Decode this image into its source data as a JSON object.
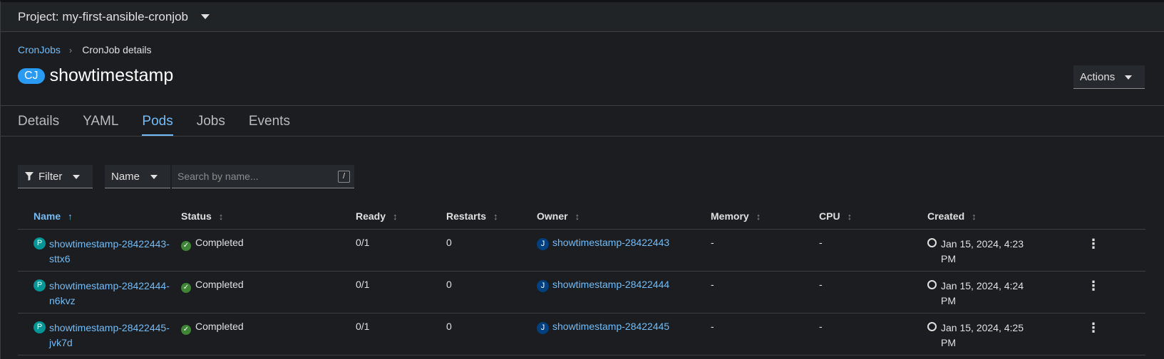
{
  "project_bar": {
    "label": "Project: my-first-ansible-cronjob"
  },
  "breadcrumb": {
    "parent": "CronJobs",
    "separator": "›",
    "current": "CronJob details"
  },
  "header": {
    "badge": "CJ",
    "title": "showtimestamp",
    "actions_label": "Actions"
  },
  "tabs": [
    {
      "label": "Details",
      "active": false
    },
    {
      "label": "YAML",
      "active": false
    },
    {
      "label": "Pods",
      "active": true
    },
    {
      "label": "Jobs",
      "active": false
    },
    {
      "label": "Events",
      "active": false
    }
  ],
  "toolbar": {
    "filter_label": "Filter",
    "filter_type": "Name",
    "search_placeholder": "Search by name...",
    "search_shortcut": "/"
  },
  "table": {
    "columns": [
      "Name",
      "Status",
      "Ready",
      "Restarts",
      "Owner",
      "Memory",
      "CPU",
      "Created"
    ],
    "sorted_column": "Name",
    "rows": [
      {
        "pod_badge": "P",
        "name_line1": "showtimestamp-28422443-",
        "name_line2": "sttx6",
        "status": "Completed",
        "ready": "0/1",
        "restarts": "0",
        "owner_badge": "J",
        "owner": "showtimestamp-28422443",
        "memory": "-",
        "cpu": "-",
        "created_line1": "Jan 15, 2024, 4:23",
        "created_line2": "PM"
      },
      {
        "pod_badge": "P",
        "name_line1": "showtimestamp-28422444-",
        "name_line2": "n6kvz",
        "status": "Completed",
        "ready": "0/1",
        "restarts": "0",
        "owner_badge": "J",
        "owner": "showtimestamp-28422444",
        "memory": "-",
        "cpu": "-",
        "created_line1": "Jan 15, 2024, 4:24",
        "created_line2": "PM"
      },
      {
        "pod_badge": "P",
        "name_line1": "showtimestamp-28422445-",
        "name_line2": "jvk7d",
        "status": "Completed",
        "ready": "0/1",
        "restarts": "0",
        "owner_badge": "J",
        "owner": "showtimestamp-28422445",
        "memory": "-",
        "cpu": "-",
        "created_line1": "Jan 15, 2024, 4:25",
        "created_line2": "PM"
      }
    ]
  },
  "colors": {
    "link": "#73bcf7",
    "success": "#3e8635",
    "pod_badge": "#009596",
    "job_badge": "#004080",
    "cronjob_badge": "#2b9af3",
    "background": "#1b1d21"
  }
}
